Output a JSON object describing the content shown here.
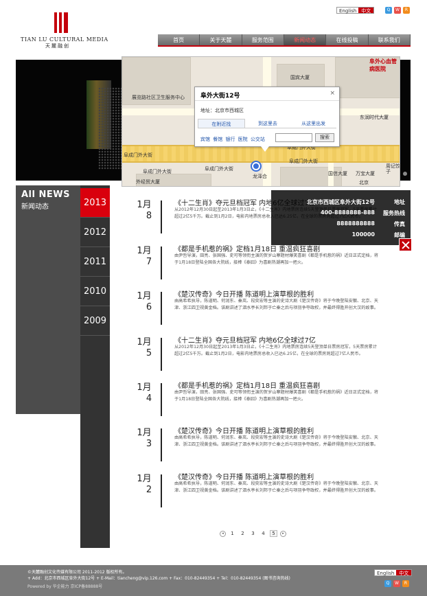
{
  "header": {
    "lang_en": "English",
    "lang_zh": "中文",
    "logo_en": "TIAN LU CULTURAL MEDIA",
    "logo_cn": "天麓融创"
  },
  "nav": [
    "首页",
    "关于天麓",
    "服务范围",
    "新闻动态",
    "在线投稿",
    "联系我们"
  ],
  "map": {
    "popup_title": "阜外大街12号",
    "popup_close": "×",
    "popup_address": "地址：北京市西城区",
    "tabs": [
      "在附近找",
      "到这里去",
      "从这里出发"
    ],
    "links": "宾馆 餐馆 银行 医院 公交站",
    "search_button": "搜索",
    "labels": {
      "hospital": "阜外心血管病医院",
      "guoxin": "国宾大厦",
      "zhanlan": "展览路社区卫生服务中心",
      "dongjian": "东润时代大厦",
      "fuwai_st1": "阜成门外大街",
      "fuwai_st2": "阜成门外大街",
      "fuwai_st3": "阜成门外大街",
      "fuwai_st4": "阜成门外大街",
      "fuwai_st5": "阜成门外大街",
      "waijing": "外经贸大厦",
      "wanbao": "万宝大厦",
      "longde": "龙泽合",
      "guoxin2": "国信大厦",
      "zhoukou": "周记饺子",
      "northwest": "北京"
    }
  },
  "contact": {
    "address": "北京市西城区阜外大街12号",
    "address_label": "地址",
    "hotline": "400-8888888-888",
    "hotline_label": "服务热线",
    "fax": "8888888888",
    "fax_label": "传真",
    "zip": "100000",
    "zip_label": "邮编"
  },
  "sidebar": {
    "title_en": "All NEWS",
    "title_cn": "新闻动态",
    "years": [
      "2013",
      "2012",
      "2011",
      "2010",
      "2009"
    ]
  },
  "entries": [
    {
      "month": "1月",
      "day": "8",
      "title": "《十二生肖》夺元旦档冠军 内地6亿全球过7亿",
      "text": "从2012年12月30日起至2013年1月3日止，《十二生肖》内地票房连续5天登顶单日票房冠军，5天票房累计超过2亿5千万。截止到1月2日，电影内地票房总收入已达6.25亿，在全球的票房则超过7亿人民币。"
    },
    {
      "month": "1月",
      "day": "7",
      "title": "《都是手机惹的祸》定档1月18日 重温疯狂喜剧",
      "text": "由尹哲导演，田亮、张国强、史可等领衔主演的贺岁山寨题材爆笑喜剧《都是手机惹的祸》近日正式定档，将于1月18日登陆全国各大院线，接棒《泰囧》为喜剧热潮再加一把火。"
    },
    {
      "month": "1月",
      "day": "6",
      "title": "《楚汉传奇》今日开播 陈道明上演草根的胜利",
      "text": "由高希希执导，陈道明、何润东、秦岚、段奕宏等主演的史诗大剧《楚汉传奇》将于今晚登陆安徽、北京、天津、浙江四卫视黄金档。该剧讲述了泗水亭长刘邦于亡秦之后与项羽争夺政权，并最终得胜开创大汉的故事。"
    },
    {
      "month": "1月",
      "day": "5",
      "title": "《十二生肖》夺元旦档冠军 内地6亿全球过7亿",
      "text": "从2012年12月30日起至2013年1月3日止，《十二生肖》内地票房连续5天登顶单日票房冠军，5天票房累计超过2亿5千万。截止到1月2日，电影内地票房总收入已达6.25亿，在全球的票房则超过7亿人民币。"
    },
    {
      "month": "1月",
      "day": "4",
      "title": "《都是手机惹的祸》定档1月18日 重温疯狂喜剧",
      "text": "由尹哲导演，田亮、张国强、史可等领衔主演的贺岁山寨题材爆笑喜剧《都是手机惹的祸》近日正式定档，将于1月18日登陆全国各大院线，接棒《泰囧》为喜剧热潮再加一把火。"
    },
    {
      "month": "1月",
      "day": "3",
      "title": "《楚汉传奇》今日开播 陈道明上演草根的胜利",
      "text": "由高希希执导，陈道明、何润东、秦岚、段奕宏等主演的史诗大剧《楚汉传奇》将于今晚登陆安徽、北京、天津、浙江四卫视黄金档。该剧讲述了泗水亭长刘邦于亡秦之后与项羽争夺政权，并最终得胜开创大汉的故事。"
    },
    {
      "month": "1月",
      "day": "2",
      "title": "《楚汉传奇》今日开播 陈道明上演草根的胜利",
      "text": "由高希希执导，陈道明、何润东、秦岚、段奕宏等主演的史诗大剧《楚汉传奇》将于今晚登陆安徽、北京、天津、浙江四卫视黄金档。该剧讲述了泗水亭长刘邦于亡秦之后与项羽争夺政权，并最终得胜开创大汉的故事。"
    }
  ],
  "pager": {
    "prev": "◂",
    "pages": [
      "1",
      "2",
      "3",
      "4",
      "5"
    ],
    "next": "▸"
  },
  "footer": {
    "copyright": "©天麓融创文化传媒有限公司 2011-2012 版权所有。",
    "contact": "+ Add：北京市西城区阜外大街12号 + E-Mail：tiancheng@vip.126.com + Fax：010-82449354 + Tel：010-82449354 (图书咨询热线)",
    "powered": "Powered by 华企能力 京ICP备88888号"
  }
}
